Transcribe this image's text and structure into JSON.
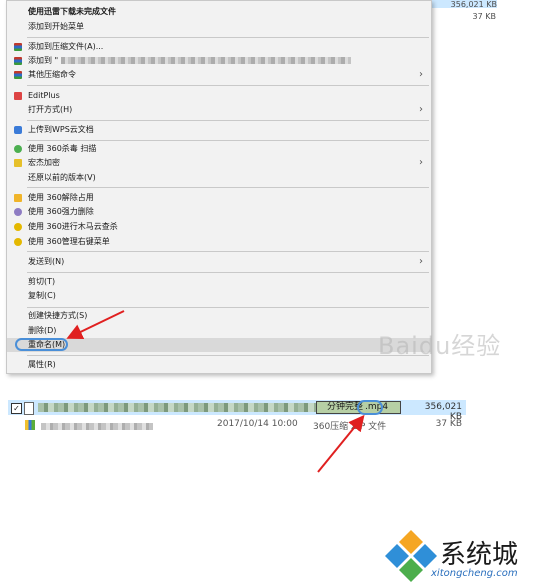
{
  "background": {
    "top_size_1": "356,021 KB",
    "top_size_2": "37 KB"
  },
  "menu": {
    "items": [
      {
        "label": "使用迅雷下载未完成文件",
        "bold": true
      },
      {
        "label": "添加到开始菜单"
      },
      {
        "label": "添加到压缩文件(A)..."
      },
      {
        "label": "添加到 \""
      },
      {
        "label": "其他压缩命令"
      },
      {
        "label": "EditPlus"
      },
      {
        "label": "打开方式(H)"
      },
      {
        "label": "上传到WPS云文档"
      },
      {
        "label": "使用 360杀毒 扫描"
      },
      {
        "label": "宏杰加密"
      },
      {
        "label": "还原以前的版本(V)"
      },
      {
        "label": "使用 360解除占用"
      },
      {
        "label": "使用 360强力删除"
      },
      {
        "label": "使用 360进行木马云查杀"
      },
      {
        "label": "使用 360管理右键菜单"
      },
      {
        "label": "发送到(N)"
      },
      {
        "label": "剪切(T)"
      },
      {
        "label": "复制(C)"
      },
      {
        "label": "创建快捷方式(S)"
      },
      {
        "label": "删除(D)"
      },
      {
        "label": "重命名(M)"
      },
      {
        "label": "属性(R)"
      }
    ],
    "arrow_glyph": "›"
  },
  "files": {
    "row1": {
      "name_suffix": "分钟完整",
      "extension": ".mp4",
      "size": "356,021 KB"
    },
    "row2": {
      "date": "2017/10/14 10:00",
      "type": "360压缩 ZIP 文件",
      "size": "37 KB"
    }
  },
  "watermark": {
    "text": "Baidu经验"
  },
  "logo": {
    "text": "系统城",
    "url": "xitongcheng.com"
  },
  "colors": {
    "selection": "#cce8ff",
    "annotation_arrow": "#e02020",
    "annotation_oval": "#4a8fd8",
    "menu_background": "#f2f2f2"
  }
}
